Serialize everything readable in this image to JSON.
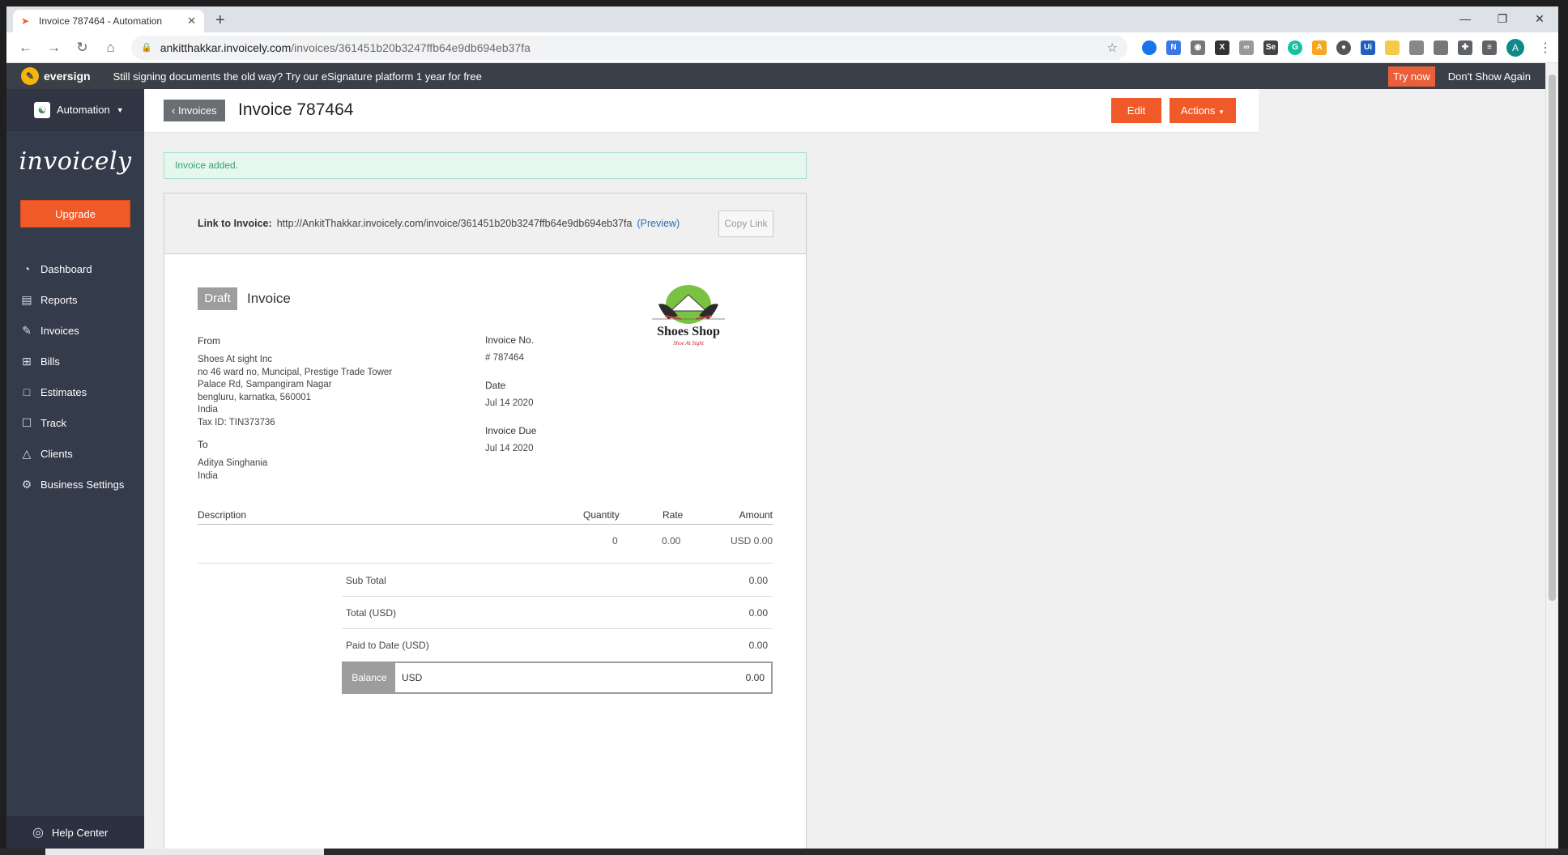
{
  "browser": {
    "tab_title": "Invoice 787464 - Automation",
    "url_host": "ankitthakkar.invoicely.com",
    "url_path": "/invoices/361451b20b3247ffb64e9db694eb37fa",
    "avatar_letter": "A"
  },
  "promo": {
    "brand": "eversign",
    "message": "Still signing documents the old way? Try our eSignature platform 1 year for free",
    "try_now": "Try now",
    "dismiss": "Don't Show Again"
  },
  "sidebar": {
    "account": "Automation",
    "brand": "invoicely",
    "upgrade": "Upgrade",
    "items": [
      {
        "label": "Dashboard",
        "icon": "dashboard-icon"
      },
      {
        "label": "Reports",
        "icon": "reports-icon"
      },
      {
        "label": "Invoices",
        "icon": "invoices-icon"
      },
      {
        "label": "Bills",
        "icon": "bills-icon"
      },
      {
        "label": "Estimates",
        "icon": "estimates-icon"
      },
      {
        "label": "Track",
        "icon": "track-icon"
      },
      {
        "label": "Clients",
        "icon": "clients-icon"
      },
      {
        "label": "Business Settings",
        "icon": "settings-icon"
      }
    ],
    "help": "Help Center"
  },
  "header": {
    "back": "Invoices",
    "title": "Invoice 787464",
    "edit": "Edit",
    "actions": "Actions"
  },
  "flash": "Invoice added.",
  "link_box": {
    "label": "Link to Invoice:",
    "url": "http://AnkitThakkar.invoicely.com/invoice/361451b20b3247ffb64e9db694eb37fa",
    "preview": "(Preview)",
    "copy": "Copy Link"
  },
  "invoice": {
    "status": "Draft",
    "doc_type": "Invoice",
    "logo_text": "Shoes Shop",
    "logo_tagline": "Shoe At Sight",
    "from_label": "From",
    "from_lines": [
      "Shoes At sight Inc",
      "no 46 ward no, Muncipal, Prestige Trade Tower",
      "Palace Rd, Sampangiram Nagar",
      "bengluru, karnatka, 560001",
      "India",
      "Tax ID: TIN373736"
    ],
    "to_label": "To",
    "to_lines": [
      "Aditya Singhania",
      "India"
    ],
    "number_label": "Invoice No.",
    "number": "# 787464",
    "date_label": "Date",
    "date": "Jul 14 2020",
    "due_label": "Invoice Due",
    "due": "Jul 14 2020",
    "columns": {
      "description": "Description",
      "quantity": "Quantity",
      "rate": "Rate",
      "amount": "Amount"
    },
    "row": {
      "quantity": "0",
      "rate": "0.00",
      "amount": "USD 0.00"
    },
    "subtotal_label": "Sub Total",
    "subtotal": "0.00",
    "total_label": "Total (USD)",
    "total": "0.00",
    "paid_label": "Paid to Date (USD)",
    "paid": "0.00",
    "balance_label": "Balance",
    "balance_currency": "USD",
    "balance": "0.00"
  },
  "colors": {
    "accent": "#f05a28",
    "sidebar": "#343b4a",
    "banner": "#3b3f47"
  }
}
